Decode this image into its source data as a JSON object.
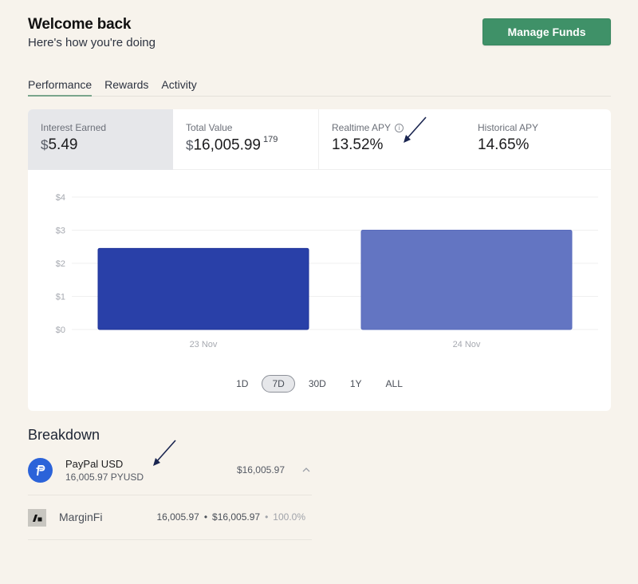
{
  "header": {
    "title": "Welcome back",
    "subtitle": "Here's how you're doing",
    "manage_button": "Manage Funds"
  },
  "tabs": [
    {
      "label": "Performance",
      "active": true
    },
    {
      "label": "Rewards",
      "active": false
    },
    {
      "label": "Activity",
      "active": false
    }
  ],
  "stats": {
    "interest_earned": {
      "label": "Interest Earned",
      "currency": "$",
      "value": "5.49"
    },
    "total_value": {
      "label": "Total Value",
      "currency": "$",
      "value": "16,005.99",
      "extra_digits": "179"
    },
    "realtime_apy": {
      "label": "Realtime APY",
      "value": "13.52%",
      "icon": "info-icon"
    },
    "historical_apy": {
      "label": "Historical APY",
      "value": "14.65%"
    }
  },
  "chart_data": {
    "type": "bar",
    "categories": [
      "23 Nov",
      "24 Nov"
    ],
    "values": [
      2.45,
      3.0
    ],
    "colors": [
      "#2940a8",
      "#6375c2"
    ],
    "title": "",
    "xlabel": "",
    "ylabel": "",
    "ylim": [
      0,
      4
    ],
    "yticks": [
      "$0",
      "$1",
      "$2",
      "$3",
      "$4"
    ],
    "grid": true
  },
  "ranges": [
    {
      "label": "1D",
      "active": false
    },
    {
      "label": "7D",
      "active": true
    },
    {
      "label": "30D",
      "active": false
    },
    {
      "label": "1Y",
      "active": false
    },
    {
      "label": "ALL",
      "active": false
    }
  ],
  "breakdown": {
    "title": "Breakdown",
    "asset": {
      "name": "PayPal USD",
      "amount": "16,005.97 PYUSD",
      "usd_value": "$16,005.97",
      "icon": "paypal-usd-icon",
      "expanded": true
    },
    "protocols": [
      {
        "name": "MarginFi",
        "amount": "16,005.97",
        "usd_value": "$16,005.97",
        "share": "100.0%",
        "icon": "marginfi-icon",
        "separator": "•"
      }
    ]
  },
  "colors": {
    "accent_green": "#3f9168",
    "bar_primary": "#2940a8",
    "bar_secondary": "#6375c2",
    "background": "#f7f3ec"
  }
}
